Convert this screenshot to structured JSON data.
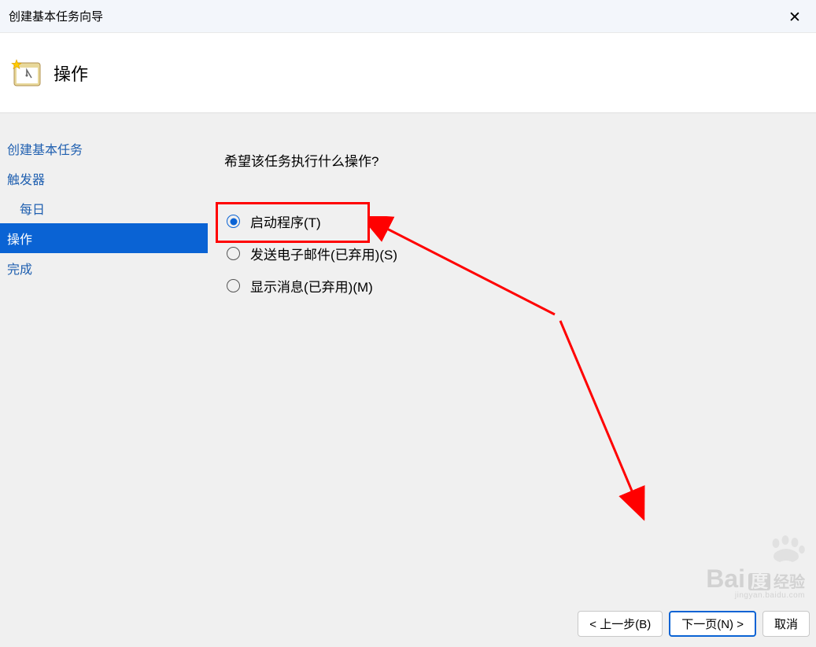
{
  "titlebar": {
    "title": "创建基本任务向导"
  },
  "header": {
    "title": "操作"
  },
  "sidebar": {
    "items": [
      {
        "label": "创建基本任务",
        "sub": false,
        "selected": false
      },
      {
        "label": "触发器",
        "sub": false,
        "selected": false
      },
      {
        "label": "每日",
        "sub": true,
        "selected": false
      },
      {
        "label": "操作",
        "sub": false,
        "selected": true
      },
      {
        "label": "完成",
        "sub": false,
        "selected": false
      }
    ]
  },
  "main": {
    "prompt": "希望该任务执行什么操作?",
    "options": [
      {
        "label": "启动程序(T)",
        "checked": true
      },
      {
        "label": "发送电子邮件(已弃用)(S)",
        "checked": false
      },
      {
        "label": "显示消息(已弃用)(M)",
        "checked": false
      }
    ]
  },
  "footer": {
    "back": "< 上一步(B)",
    "next": "下一页(N) >",
    "cancel": "取消"
  },
  "watermark": {
    "brand": "Bai",
    "du": "度",
    "brand2": "经验",
    "sub": "jingyan.baidu.com"
  }
}
